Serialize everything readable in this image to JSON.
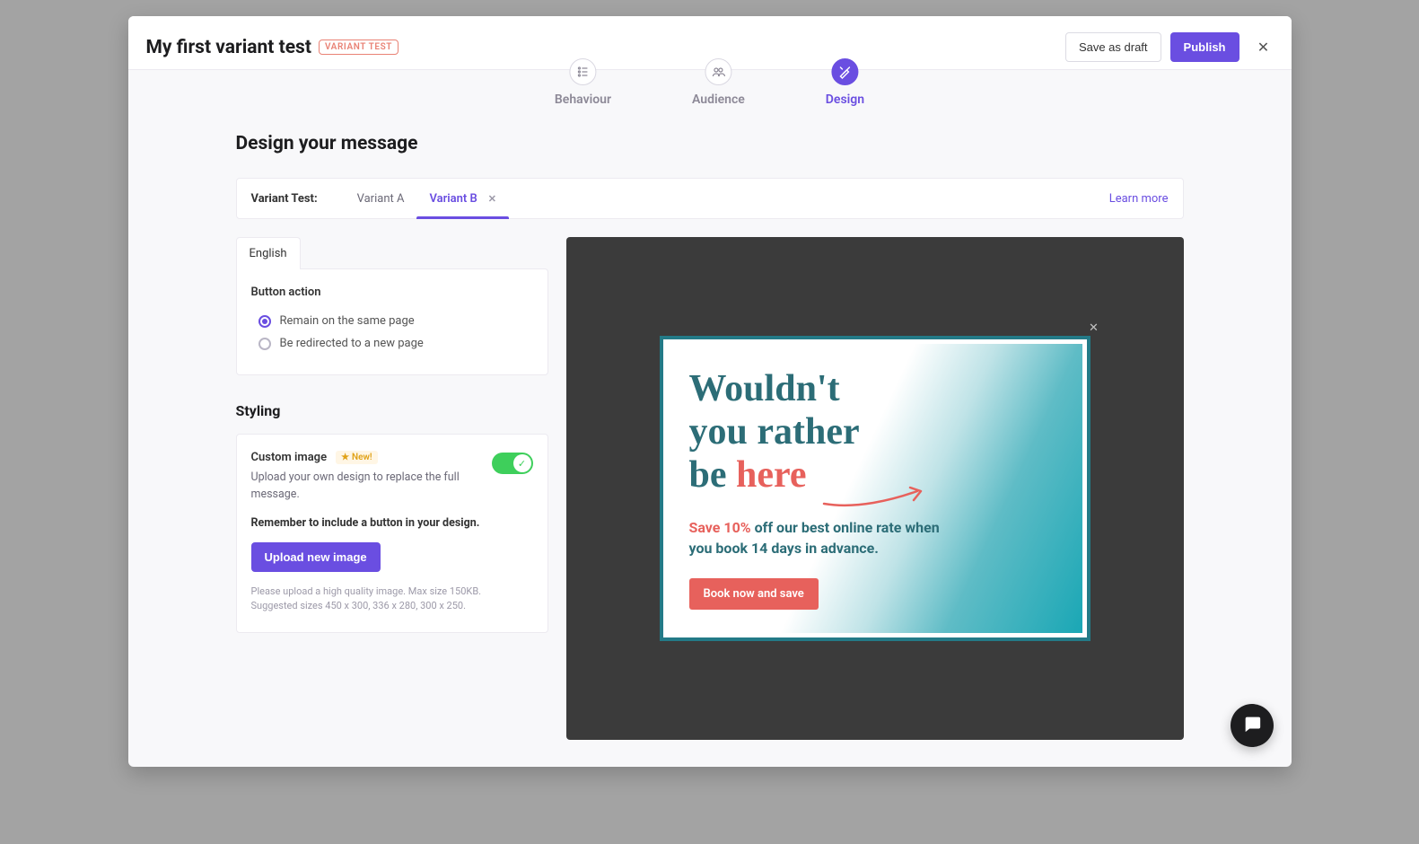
{
  "header": {
    "title": "My first variant test",
    "badge": "VARIANT TEST",
    "save_draft": "Save as draft",
    "publish": "Publish"
  },
  "steps": {
    "behaviour": "Behaviour",
    "audience": "Audience",
    "design": "Design"
  },
  "section_heading": "Design your message",
  "variant_bar": {
    "label": "Variant Test:",
    "tab_a": "Variant A",
    "tab_b": "Variant B",
    "learn_more": "Learn more"
  },
  "language_tab": "English",
  "button_action": {
    "heading": "Button action",
    "remain": "Remain on the same page",
    "redirect": "Be redirected to a new page"
  },
  "styling_heading": "Styling",
  "custom_image": {
    "title": "Custom image",
    "new_badge": "New!",
    "desc": "Upload your own design to replace the full message.",
    "remember": "Remember to include a button in your design.",
    "upload_button": "Upload new image",
    "help1": "Please upload a high quality image. Max size 150KB.",
    "help2": "Suggested sizes 450 x 300, 336 x 280, 300 x 250."
  },
  "preview": {
    "headline_l1": "Wouldn't",
    "headline_l2": "you rather",
    "headline_l3a": "be ",
    "headline_l3b": "here",
    "sub_red": "Save 10%",
    "sub_rest": " off our best online rate when you book 14 days in advance.",
    "cta": "Book now and save"
  },
  "colors": {
    "primary": "#6a4ee1",
    "accent_red": "#e7615c",
    "teal": "#237a87"
  }
}
